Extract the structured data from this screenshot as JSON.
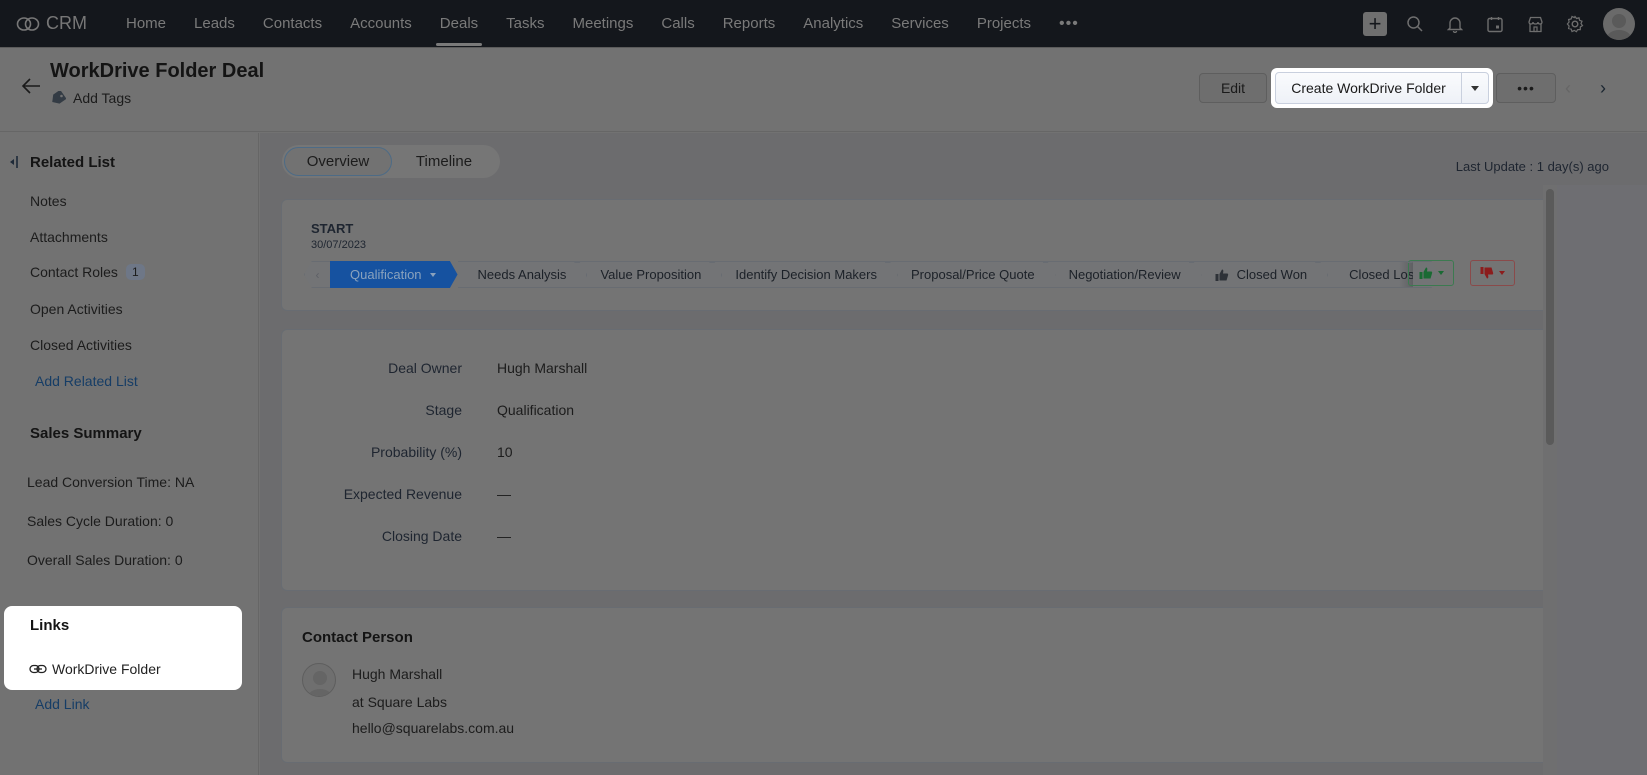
{
  "app": {
    "name": "CRM",
    "nav": [
      "Home",
      "Leads",
      "Contacts",
      "Accounts",
      "Deals",
      "Tasks",
      "Meetings",
      "Calls",
      "Reports",
      "Analytics",
      "Services",
      "Projects"
    ],
    "active_nav": "Deals",
    "more_label": "•••",
    "icons": [
      "plus-icon",
      "search-icon",
      "bell-icon",
      "calendar-icon",
      "marketplace-icon",
      "gear-icon",
      "avatar"
    ]
  },
  "header": {
    "title": "WorkDrive Folder Deal",
    "add_tags": "Add Tags",
    "edit_label": "Edit",
    "create_folder_label": "Create WorkDrive Folder",
    "more_label": "•••",
    "prev": "‹",
    "next": "›"
  },
  "sidebar": {
    "related_list_title": "Related List",
    "related_items": [
      {
        "label": "Notes"
      },
      {
        "label": "Attachments"
      },
      {
        "label": "Contact Roles",
        "badge": "1"
      },
      {
        "label": "Open Activities"
      },
      {
        "label": "Closed Activities"
      }
    ],
    "add_related_list": "Add Related List",
    "sales_summary_title": "Sales Summary",
    "summary": [
      "Lead Conversion Time: NA",
      "Sales Cycle Duration: 0",
      "Overall Sales Duration: 0"
    ],
    "links_title": "Links",
    "links": [
      "WorkDrive Folder"
    ],
    "add_link": "Add Link"
  },
  "main": {
    "tabs": [
      "Overview",
      "Timeline"
    ],
    "active_tab": "Overview",
    "last_update": "Last Update : 1 day(s) ago",
    "start_label": "START",
    "start_date": "30/07/2023",
    "stages": [
      "Qualification",
      "Needs Analysis",
      "Value Proposition",
      "Identify Decision Makers",
      "Proposal/Price Quote",
      "Negotiation/Review",
      "Closed Won",
      "Closed Lost"
    ],
    "current_stage": "Qualification",
    "colors": {
      "current_stage_bg": "#1652a0",
      "won": "#1a6a33",
      "lost": "#8c1c1c",
      "link": "#163d66"
    },
    "fields": [
      {
        "label": "Deal Owner",
        "value": "Hugh Marshall"
      },
      {
        "label": "Stage",
        "value": "Qualification"
      },
      {
        "label": "Probability (%)",
        "value": "10"
      },
      {
        "label": "Expected Revenue",
        "value": "—"
      },
      {
        "label": "Closing Date",
        "value": "—"
      }
    ],
    "contact": {
      "title": "Contact Person",
      "name": "Hugh Marshall",
      "company": "at Square Labs",
      "email": "hello@squarelabs.com.au"
    }
  }
}
